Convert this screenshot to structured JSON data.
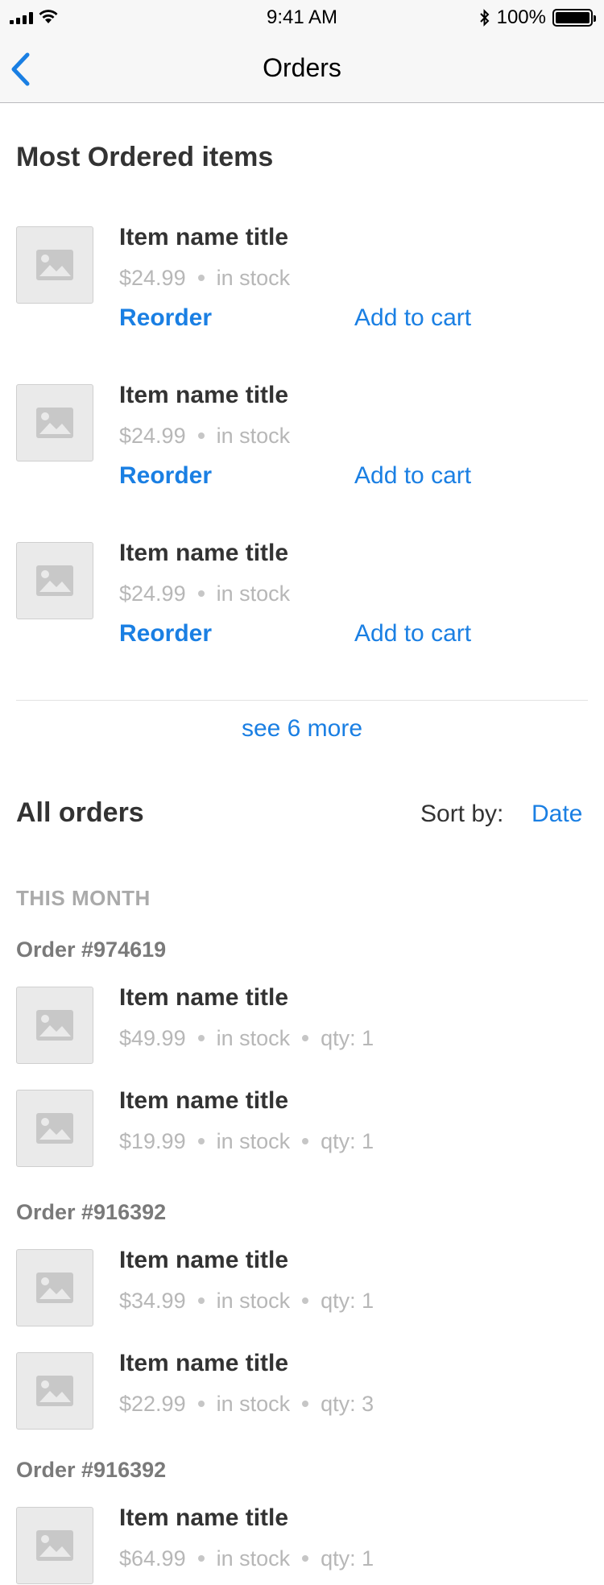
{
  "status_bar": {
    "time": "9:41 AM",
    "battery": "100%",
    "battery_level": 1.0,
    "icons": [
      "signal-icon",
      "wifi-icon",
      "bluetooth-icon",
      "battery-icon"
    ]
  },
  "nav": {
    "title": "Orders",
    "back_icon": "chevron-left-icon"
  },
  "most_ordered": {
    "title": "Most Ordered items",
    "items": [
      {
        "title": "Item name title",
        "price": "$24.99",
        "stock": "in stock",
        "reorder": "Reorder",
        "add_to_cart": "Add to cart"
      },
      {
        "title": "Item name title",
        "price": "$24.99",
        "stock": "in stock",
        "reorder": "Reorder",
        "add_to_cart": "Add to cart"
      },
      {
        "title": "Item name title",
        "price": "$24.99",
        "stock": "in stock",
        "reorder": "Reorder",
        "add_to_cart": "Add to cart"
      }
    ],
    "see_more": "see 6 more"
  },
  "all_orders": {
    "title": "All orders",
    "sort_label": "Sort by:",
    "sort_value": "Date",
    "group_label": "THIS MONTH",
    "orders": [
      {
        "number": "Order #974619",
        "items": [
          {
            "title": "Item name title",
            "price": "$49.99",
            "stock": "in stock",
            "qty": "qty: 1"
          },
          {
            "title": "Item name title",
            "price": "$19.99",
            "stock": "in stock",
            "qty": "qty: 1"
          }
        ]
      },
      {
        "number": "Order #916392",
        "items": [
          {
            "title": "Item name title",
            "price": "$34.99",
            "stock": "in stock",
            "qty": "qty: 1"
          },
          {
            "title": "Item name title",
            "price": "$22.99",
            "stock": "in stock",
            "qty": "qty: 3"
          }
        ]
      },
      {
        "number": "Order #916392",
        "items": [
          {
            "title": "Item name title",
            "price": "$64.99",
            "stock": "in stock",
            "qty": "qty: 1"
          }
        ]
      }
    ]
  },
  "colors": {
    "accent": "#1a7fe3",
    "text": "#333333",
    "muted": "#b7b7b7",
    "placeholder": "#eaeaea"
  },
  "icons": {
    "thumbnail": "image-placeholder-icon"
  }
}
